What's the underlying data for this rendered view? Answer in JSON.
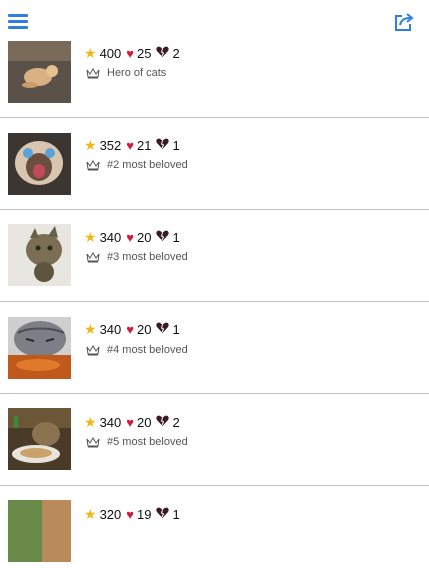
{
  "toolbar": {
    "menu_icon": "hamburger-menu-icon",
    "share_icon": "share-icon",
    "accent": "#2f7fe0"
  },
  "rows": [
    {
      "stars": "400",
      "hearts": "25",
      "broken": "2",
      "rank": "Hero of cats"
    },
    {
      "stars": "352",
      "hearts": "21",
      "broken": "1",
      "rank": "#2 most beloved"
    },
    {
      "stars": "340",
      "hearts": "20",
      "broken": "1",
      "rank": "#3 most beloved"
    },
    {
      "stars": "340",
      "hearts": "20",
      "broken": "1",
      "rank": "#4 most beloved"
    },
    {
      "stars": "340",
      "hearts": "20",
      "broken": "2",
      "rank": "#5 most beloved"
    },
    {
      "stars": "320",
      "hearts": "19",
      "broken": "1",
      "rank": ""
    }
  ],
  "icons": {
    "star": "star-icon",
    "heart": "heart-icon",
    "broken_heart": "broken-heart-icon",
    "crown": "crown-icon"
  },
  "colors": {
    "star": "#f2b818",
    "heart": "#d21b3a",
    "broken_heart": "#3a1a22"
  }
}
